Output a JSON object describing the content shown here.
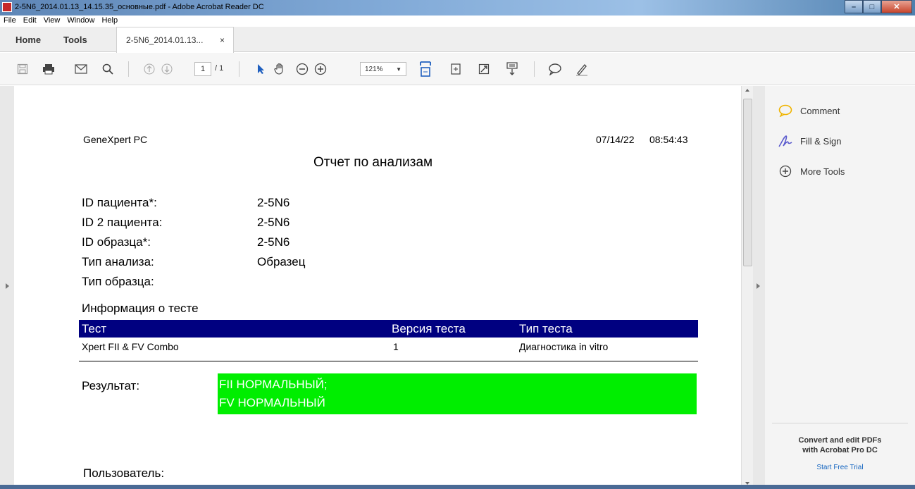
{
  "window": {
    "title": "2-5N6_2014.01.13_14.15.35_основные.pdf - Adobe Acrobat Reader DC"
  },
  "menu": [
    "File",
    "Edit",
    "View",
    "Window",
    "Help"
  ],
  "tabs": {
    "home": "Home",
    "tools": "Tools",
    "document": "2-5N6_2014.01.13...",
    "close_symbol": "×"
  },
  "toolbar": {
    "page_current": "1",
    "page_total": "/ 1",
    "zoom": "121%"
  },
  "document": {
    "header_left": "GeneXpert PC",
    "header_date": "07/14/22",
    "header_time": "08:54:43",
    "title": "Отчет по анализам",
    "fields": [
      {
        "label": "ID пациента*:",
        "value": "2-5N6"
      },
      {
        "label": "ID 2 пациента:",
        "value": "2-5N6"
      },
      {
        "label": "ID образца*:",
        "value": "2-5N6"
      },
      {
        "label": "Тип анализа:",
        "value": "Образец"
      },
      {
        "label": "Тип образца:",
        "value": ""
      }
    ],
    "test_info_heading": "Информация о тесте",
    "test_table": {
      "headers": [
        "Тест",
        "Версия теста",
        "Тип теста"
      ],
      "row": [
        "Xpert FII & FV Combo",
        "1",
        "Диагностика in vitro"
      ]
    },
    "result_label": "Результат:",
    "result_lines": [
      "FII НОРМАЛЬНЫЙ;",
      "FV НОРМАЛЬНЫЙ"
    ],
    "user_label": "Пользователь:"
  },
  "right_pane": {
    "items": [
      "Comment",
      "Fill & Sign",
      "More Tools"
    ],
    "promo_line1": "Convert and edit PDFs",
    "promo_line2": "with Acrobat Pro DC",
    "promo_link": "Start Free Trial"
  },
  "colors": {
    "table_header_bg": "#000080",
    "result_bg": "#00ee00",
    "link": "#1565c0"
  }
}
